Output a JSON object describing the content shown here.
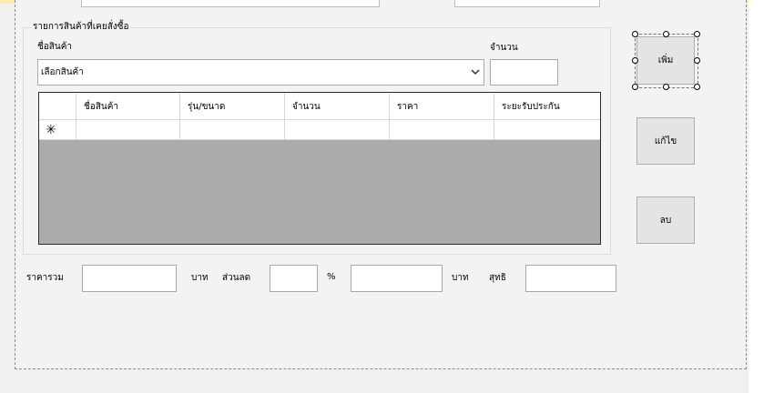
{
  "groupbox": {
    "title": "รายการสินค้าที่เคยสั่งซื้อ",
    "product_label": "ชื่อสินค้า",
    "quantity_label": "จำนวน",
    "product_select_value": "เลือกสินค้า",
    "quantity_value": ""
  },
  "grid": {
    "columns": [
      "ชื่อสินค้า",
      "รุ่น/ขนาด",
      "จำนวน",
      "ราคา",
      "ระยะรับประกัน"
    ],
    "new_row_marker": "✳"
  },
  "buttons": {
    "add": "เพิ่ม",
    "edit": "แก้ไข",
    "delete": "ลบ"
  },
  "totals": {
    "total_label": "ราคารวม",
    "baht_1": "บาท",
    "discount_label": "ส่วนลด",
    "percent": "%",
    "baht_2": "บาท",
    "net_label": "สุทธิ",
    "total_value": "",
    "discount_percent_value": "",
    "discount_baht_value": "",
    "net_value": ""
  }
}
